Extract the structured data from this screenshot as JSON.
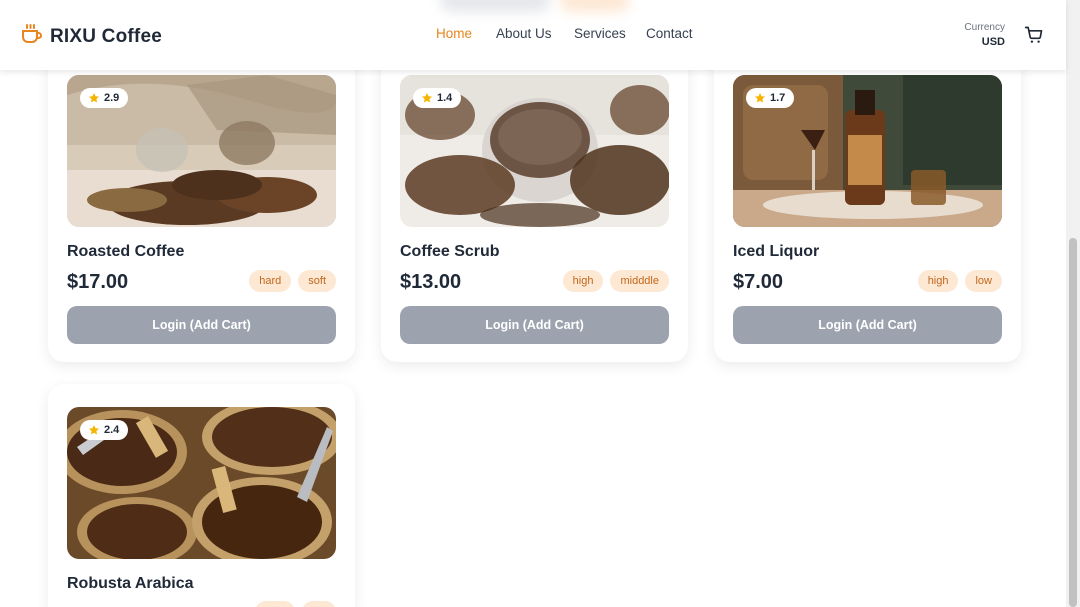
{
  "brand": {
    "name": "RIXU Coffee",
    "accent": "#e8851c"
  },
  "nav": {
    "items": [
      "Home",
      "About Us",
      "Services",
      "Contact"
    ],
    "active": "Home"
  },
  "currency": {
    "label": "Currency",
    "value": "USD"
  },
  "icons": {
    "logo": "coffee-cup-icon",
    "cart": "shopping-cart-icon",
    "rating": "star-icon"
  },
  "colors": {
    "tag_bg": "#fde8d4",
    "tag_text": "#c2671b",
    "button_disabled": "#9ca3af",
    "star": "#f5b400"
  },
  "products": [
    {
      "name": "Roasted Coffee",
      "price": "$17.00",
      "rating": "2.9",
      "tags": [
        "hard",
        "soft"
      ],
      "button": "Login (Add Cart)"
    },
    {
      "name": "Coffee Scrub",
      "price": "$13.00",
      "rating": "1.4",
      "tags": [
        "high",
        "midddle"
      ],
      "button": "Login (Add Cart)"
    },
    {
      "name": "Iced Liquor",
      "price": "$7.00",
      "rating": "1.7",
      "tags": [
        "high",
        "low"
      ],
      "button": "Login (Add Cart)"
    },
    {
      "name": "Robusta Arabica",
      "price": "",
      "rating": "2.4",
      "tags": [],
      "button": ""
    }
  ]
}
